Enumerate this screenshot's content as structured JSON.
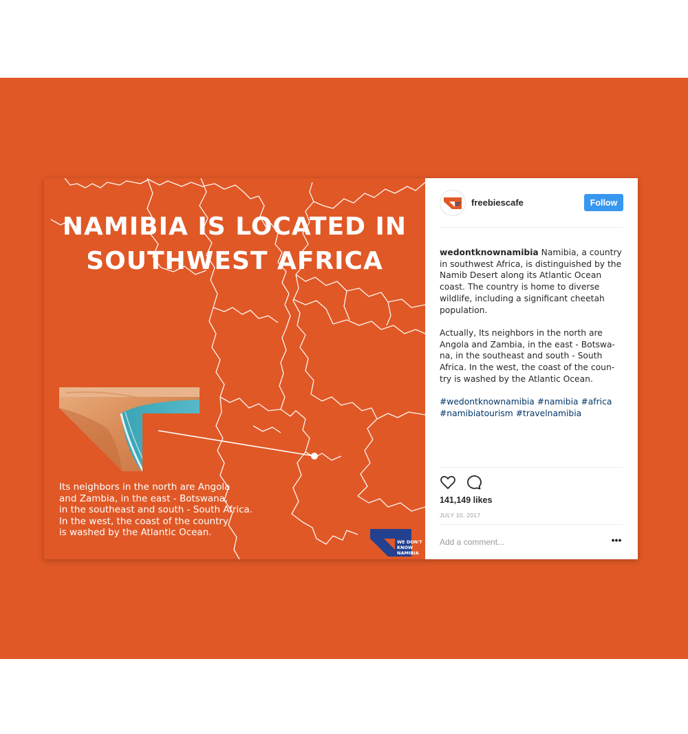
{
  "colors": {
    "page_bg": "#ffffff",
    "brand_orange": "#e05826",
    "follow_blue": "#3897f0",
    "hashtag_blue": "#003569",
    "logo_navy": "#23418f"
  },
  "media": {
    "headline": [
      "NAMIBIA IS LOCATED IN",
      "SOUTHWEST AFRICA"
    ],
    "caption": [
      "Its neighbors in the north are Angola",
      "and Zambia, in the east - Botswana,",
      "in the southeast and south - South Africa.",
      "In the west, the coast of the country",
      "is washed by the Atlantic Ocean."
    ],
    "brand_text": [
      "WE DON'T",
      "KNOW",
      "NAMIBIA"
    ],
    "icons": [
      "map-outline",
      "coast-photo",
      "location-pin",
      "brand-logo"
    ]
  },
  "sidebar": {
    "username": "freebiescafe",
    "follow_label": "Follow",
    "post_author": "wedontknownamibia",
    "post_body_1": " Namibia, a country in southwest Africa, is distinguished by the Namib Desert along its Atlantic Ocean coast. The country is home to diverse wildlife, including a significant cheetah population.",
    "post_body_2": "Actually, Its neighbors in the north are Angola and Zambia, in the east - Botswa-na, in the southeast and south - South Africa. In the west, the coast of the coun-try is washed by the Atlantic Ocean.",
    "hashtags": "#wedontknownamibia #namibia #africa #namibiatourism #travelnamibia",
    "likes": "141,149 likes",
    "date": "JULY 10, 2017",
    "comment_placeholder": "Add a comment...",
    "more_label": "•••",
    "icons": [
      "heart-icon",
      "comment-icon",
      "more-icon"
    ]
  }
}
